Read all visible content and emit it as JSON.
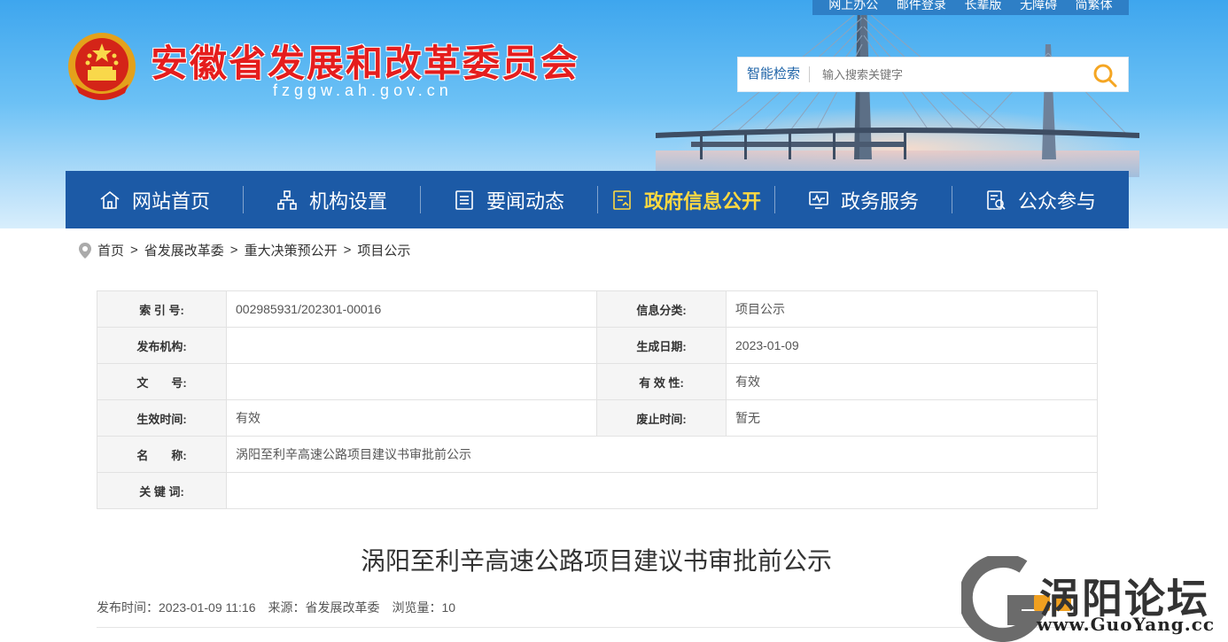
{
  "header": {
    "top_links": [
      "网上办公",
      "邮件登录",
      "长辈版",
      "无障碍",
      "简繁体"
    ],
    "site_title": "安徽省发展和改革委员会",
    "site_domain": "fzggw.ah.gov.cn",
    "search": {
      "label": "智能检索",
      "placeholder": "输入搜索关键字"
    }
  },
  "nav": {
    "items": [
      {
        "label": "网站首页",
        "icon": "home-icon"
      },
      {
        "label": "机构设置",
        "icon": "org-chart-icon"
      },
      {
        "label": "要闻动态",
        "icon": "news-icon"
      },
      {
        "label": "政府信息公开",
        "icon": "document-icon",
        "active": true
      },
      {
        "label": "政务服务",
        "icon": "monitor-icon"
      },
      {
        "label": "公众参与",
        "icon": "search-doc-icon"
      }
    ]
  },
  "breadcrumb": [
    "首页",
    "省发展改革委",
    "重大决策预公开",
    "项目公示"
  ],
  "info": {
    "index_label": "索 引 号:",
    "index_value": "002985931/202301-00016",
    "category_label": "信息分类:",
    "category_value": "项目公示",
    "publisher_label": "发布机构:",
    "publisher_value": "",
    "created_label": "生成日期:",
    "created_value": "2023-01-09",
    "docno_label": "文　　号:",
    "docno_value": "",
    "validity_label": "有 效 性:",
    "validity_value": "有效",
    "effective_label": "生效时间:",
    "effective_value": "有效",
    "abolish_label": "废止时间:",
    "abolish_value": "暂无",
    "name_label": "名　　称:",
    "name_value": "涡阳至利辛高速公路项目建议书审批前公示",
    "keywords_label": "关 键 词:",
    "keywords_value": ""
  },
  "article": {
    "title": "涡阳至利辛高速公路项目建议书审批前公示",
    "publish_time": "发布时间：2023-01-09 11:16",
    "source": "来源：省发展改革委",
    "views": "浏览量：10"
  },
  "watermark": {
    "text": "涡阳论坛",
    "url": "www.GuoYang.cc"
  },
  "colors": {
    "nav_bg": "#1c5aa6",
    "nav_active": "#ffd941",
    "title_red": "#e51d1d"
  }
}
